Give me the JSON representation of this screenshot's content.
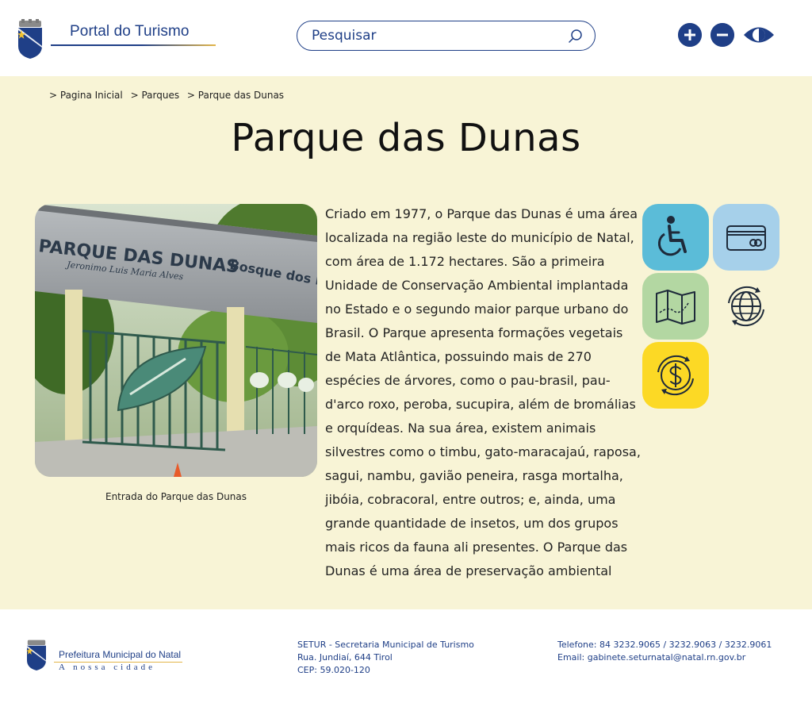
{
  "header": {
    "logo_text": "Portal do Turismo",
    "search_placeholder": "Pesquisar",
    "accessibility": {
      "zoom_in": "plus-icon",
      "zoom_out": "minus-icon",
      "contrast": "contrast-eye-icon"
    }
  },
  "breadcrumb": [
    {
      "label": "> Pagina Inicial"
    },
    {
      "label": "> Parques"
    },
    {
      "label": "> Parque das Dunas"
    }
  ],
  "page": {
    "title": "Parque das Dunas",
    "photo_caption": "Entrada do Parque das Dunas",
    "photo_sign": {
      "line1": "PARQUE DAS DUNAS",
      "line2": "Jeronimo Luis Maria Alves",
      "line3": "Bosque dos Na"
    },
    "body": " Criado em 1977, o Parque das Dunas é uma área localizada na região leste do município de Natal, com área de 1.172 hectares. São a primeira Unidade de Conservação Ambiental implantada no Estado e o segundo maior parque urbano do Brasil. O Parque apresenta formações vegetais de Mata Atlântica, possuindo mais de 270 espécies de árvores, como o pau-brasil, pau-d'arco roxo, peroba, sucupira, além de bromálias e orquídeas. Na sua área, existem animais silvestres como o timbu, gato-maracajaú, raposa, sagui, nambu, gavião peneira, rasga mortalha, jibóia, cobracoral, entre outros; e, ainda, uma grande quantidade de insetos, um dos grupos mais ricos da fauna ali presentes. O Parque das Dunas é uma área de preservação ambiental"
  },
  "info_tiles": [
    {
      "icon": "wheelchair-icon",
      "color": "#5bbcd8"
    },
    {
      "icon": "credit-card-icon",
      "color": "#a6d0ea"
    },
    {
      "icon": "map-icon",
      "color": "#b3d7a2"
    },
    {
      "icon": "globe-icon",
      "color": "transparent"
    },
    {
      "icon": "dollar-coin-icon",
      "color": "#fcd925"
    }
  ],
  "footer": {
    "logo_text": "Prefeitura Municipal do Natal",
    "logo_tagline": "A nossa cidade",
    "address": [
      "SETUR - Secretaria Municipal de Turismo",
      "Rua. Jundiaí, 644 Tirol",
      "CEP: 59.020-120"
    ],
    "contact": [
      "Telefone: 84 3232.9065 / 3232.9063 / 3232.9061",
      "Email: gabinete.seturnatal@natal.rn.gov.br"
    ]
  },
  "colors": {
    "brand_blue": "#1f3f87",
    "content_bg": "#f8f4d6",
    "accent_gold": "#e3b64a"
  }
}
